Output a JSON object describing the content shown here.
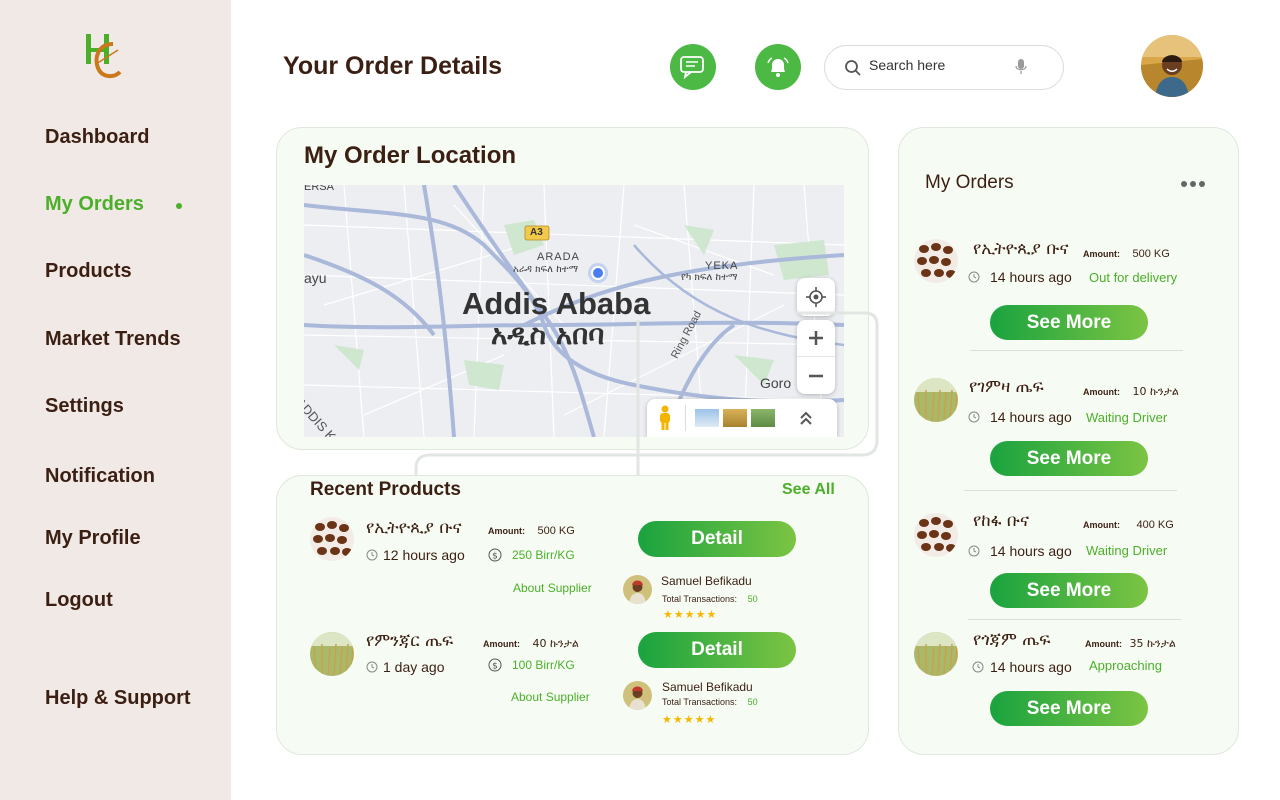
{
  "sidebar": {
    "items": [
      {
        "label": "Dashboard"
      },
      {
        "label": "My Orders"
      },
      {
        "label": "Products"
      },
      {
        "label": "Market Trends"
      },
      {
        "label": "Settings"
      },
      {
        "label": "Notification"
      },
      {
        "label": "My Profile"
      },
      {
        "label": "Logout"
      },
      {
        "label": "Help & Support"
      }
    ],
    "active": "My Orders"
  },
  "header": {
    "title": "Your Order Details",
    "search_placeholder": "Search here"
  },
  "location": {
    "title": "My Order Location",
    "map_labels": {
      "city_en": "Addis Ababa",
      "city_am": "አዲስ አበባ",
      "arada_en": "ARADA",
      "arada_am": "አራዳ ክፍለ ከተማ",
      "yeka_en": "YEKA",
      "yeka_am": "የካ ክፍለ ከተማ",
      "a3": "A3",
      "ring_road": "Ring Road",
      "goro": "Goro",
      "gersa": "ERSA",
      "ayu": "ayu",
      "addis_k": "ADDIS K"
    }
  },
  "recent": {
    "title": "Recent Products",
    "see_all": "See All",
    "items": [
      {
        "name": "የኢትዮጲያ ቡና",
        "time": "12 hours ago",
        "amount_label": "Amount:",
        "amount": "500 KG",
        "price": "250 Birr/KG",
        "about": "About Supplier",
        "button": "Detail",
        "supplier": "Samuel Befikadu",
        "tx_label": "Total Transactions:",
        "tx": "50",
        "rating": 5,
        "stars": "★★★★★"
      },
      {
        "name": "የምንጃር ጤፍ",
        "time": "1 day ago",
        "amount_label": "Amount:",
        "amount": "40 ኩንታል",
        "price": "100 Birr/KG",
        "about": "About Supplier",
        "button": "Detail",
        "supplier": "Samuel Befikadu",
        "tx_label": "Total Transactions:",
        "tx": "50",
        "rating": 5,
        "stars": "★★★★★"
      }
    ]
  },
  "orders": {
    "title": "My Orders",
    "items": [
      {
        "name": "የኢትዮጲያ ቡና",
        "amount_label": "Amount:",
        "amount": "500 KG",
        "time": "14 hours ago",
        "status": "Out for delivery",
        "button": "See More",
        "kind": "coffee"
      },
      {
        "name": "የገምዛ ጤፍ",
        "amount_label": "Amount:",
        "amount": "10 ኩንታል",
        "time": "14 hours ago",
        "status": "Waiting Driver",
        "button": "See More",
        "kind": "teff"
      },
      {
        "name": "የከፋ ቡና",
        "amount_label": "Amount:",
        "amount": "400 KG",
        "time": "14 hours ago",
        "status": "Waiting Driver",
        "button": "See More",
        "kind": "coffee"
      },
      {
        "name": "የጎጃም ጤፍ",
        "amount_label": "Amount:",
        "amount": "35 ኩንታል",
        "time": "14 hours ago",
        "status": "Approaching",
        "button": "See More",
        "kind": "teff"
      }
    ]
  },
  "colors": {
    "accent": "#4caf2a",
    "brand_dark": "#3b1f12",
    "button_start": "#1aa33f",
    "button_end": "#7cc443"
  }
}
